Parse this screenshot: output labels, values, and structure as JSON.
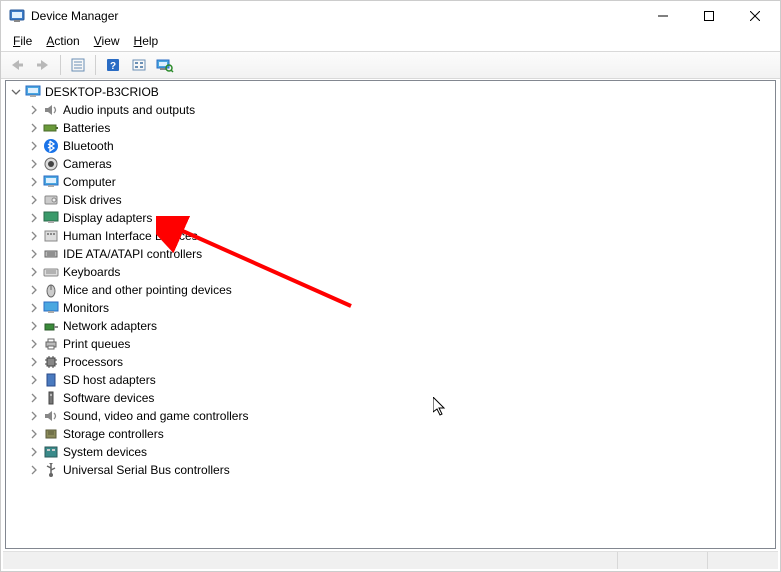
{
  "titlebar": {
    "title": "Device Manager"
  },
  "menu": {
    "file": "File",
    "action": "Action",
    "view": "View",
    "help": "Help"
  },
  "tree": {
    "root": "DESKTOP-B3CRIOB",
    "items": [
      {
        "label": "Audio inputs and outputs"
      },
      {
        "label": "Batteries"
      },
      {
        "label": "Bluetooth"
      },
      {
        "label": "Cameras"
      },
      {
        "label": "Computer"
      },
      {
        "label": "Disk drives"
      },
      {
        "label": "Display adapters"
      },
      {
        "label": "Human Interface Devices"
      },
      {
        "label": "IDE ATA/ATAPI controllers"
      },
      {
        "label": "Keyboards"
      },
      {
        "label": "Mice and other pointing devices"
      },
      {
        "label": "Monitors"
      },
      {
        "label": "Network adapters"
      },
      {
        "label": "Print queues"
      },
      {
        "label": "Processors"
      },
      {
        "label": "SD host adapters"
      },
      {
        "label": "Software devices"
      },
      {
        "label": "Sound, video and game controllers"
      },
      {
        "label": "Storage controllers"
      },
      {
        "label": "System devices"
      },
      {
        "label": "Universal Serial Bus controllers"
      }
    ]
  }
}
